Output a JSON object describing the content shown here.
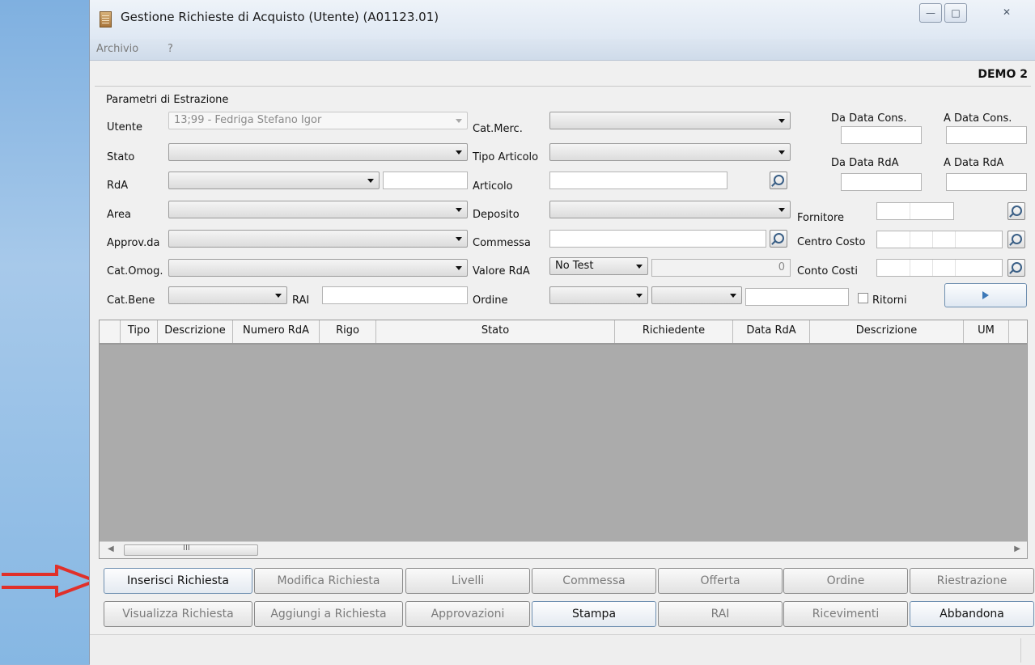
{
  "window": {
    "title": "Gestione Richieste di Acquisto (Utente) (A01123.01)"
  },
  "menu": [
    "Archivio",
    "?"
  ],
  "company": "DEMO 2",
  "filters": {
    "group_title": "Parametri di Estrazione",
    "utente": {
      "label": "Utente",
      "value": "13;99 - Fedriga Stefano Igor"
    },
    "stato": {
      "label": "Stato"
    },
    "rda": {
      "label": "RdA"
    },
    "area": {
      "label": "Area"
    },
    "approv_da": {
      "label": "Approv.da"
    },
    "cat_omog": {
      "label": "Cat.Omog."
    },
    "cat_bene": {
      "label": "Cat.Bene"
    },
    "rai": {
      "label": "RAI"
    },
    "cat_merc": {
      "label": "Cat.Merc."
    },
    "tipo_articolo": {
      "label": "Tipo Articolo"
    },
    "articolo": {
      "label": "Articolo"
    },
    "deposito": {
      "label": "Deposito"
    },
    "commessa": {
      "label": "Commessa"
    },
    "valore_rda": {
      "label": "Valore RdA",
      "mode": "No Test",
      "amount": "0"
    },
    "ordine": {
      "label": "Ordine"
    },
    "fornitore": {
      "label": "Fornitore"
    },
    "centro_costo": {
      "label": "Centro Costo"
    },
    "conto_costi": {
      "label": "Conto Costi"
    },
    "da_data_cons": {
      "label": "Da Data Cons."
    },
    "a_data_cons": {
      "label": "A Data Cons."
    },
    "da_data_rda": {
      "label": "Da Data RdA"
    },
    "a_data_rda": {
      "label": "A Data RdA"
    },
    "ritorni": {
      "label": "Ritorni"
    }
  },
  "grid": {
    "columns": [
      "Tipo",
      "Descrizione",
      "Numero RdA",
      "Rigo",
      "Stato",
      "Richiedente",
      "Data RdA",
      "Descrizione",
      "UM"
    ],
    "scroll_marker": "III"
  },
  "buttons": {
    "row1": [
      "Inserisci Richiesta",
      "Modifica  Richiesta",
      "Livelli",
      "Commessa",
      "Offerta",
      "Ordine",
      "Riestrazione"
    ],
    "row2": [
      "Visualizza Richiesta",
      "Aggiungi a Richiesta",
      "Approvazioni",
      "Stampa",
      "RAI",
      "Ricevimenti",
      "Abbandona"
    ]
  },
  "colors": {
    "arrow": "#e0302a",
    "grid_bg": "#ababab",
    "window_bg": "#f0f0f0"
  }
}
